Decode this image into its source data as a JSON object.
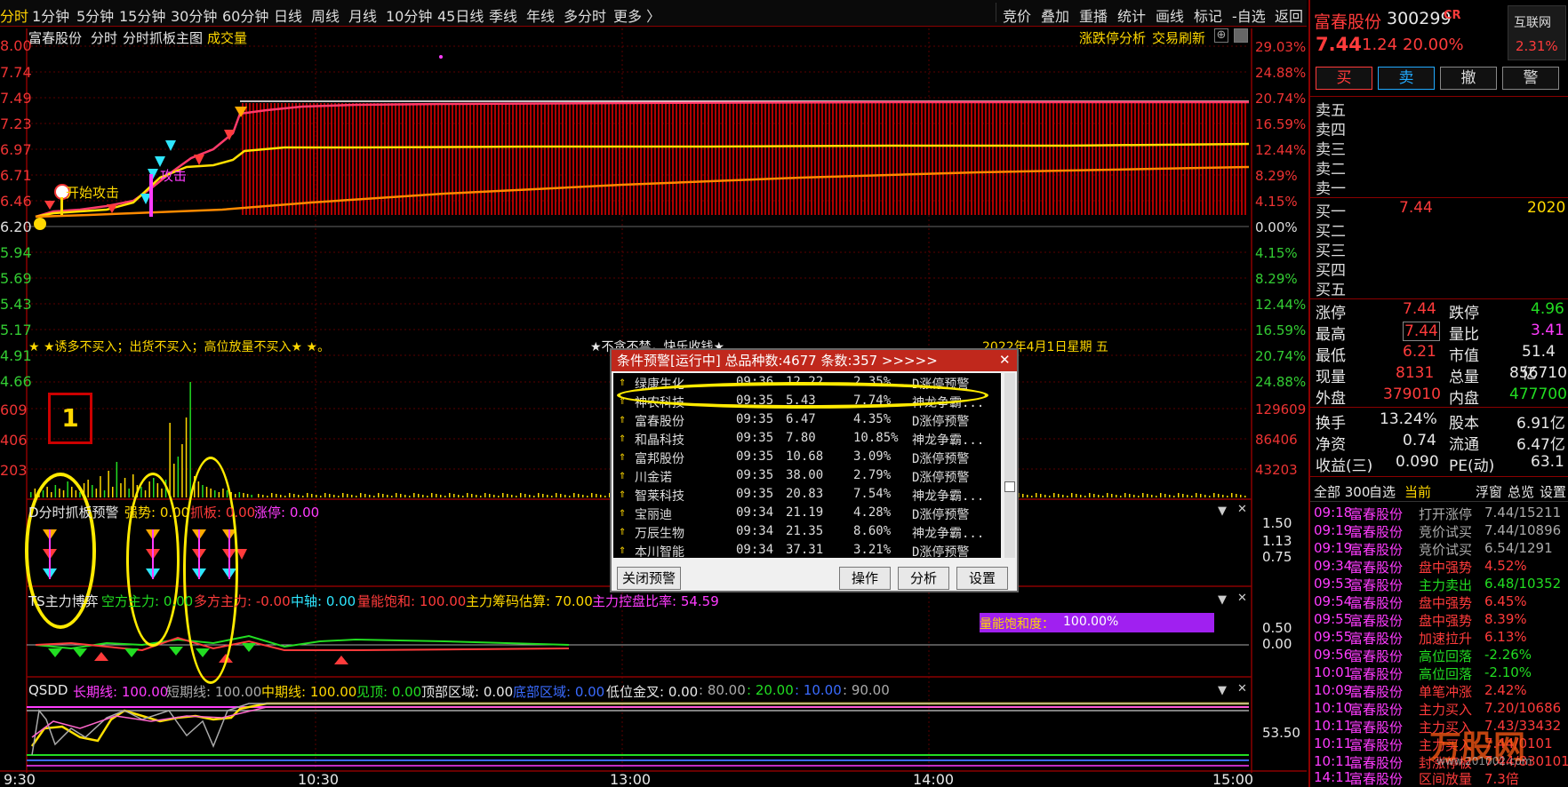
{
  "tabs": {
    "t1": "分时",
    "t2": "1分钟",
    "t3": "5分钟",
    "t4": "15分钟",
    "t5": "30分钟",
    "t6": "60分钟",
    "t7": "日线",
    "t8": "周线",
    "t9": "月线",
    "t10": "10分钟",
    "t11": "45日线",
    "t12": "季线",
    "t13": "年线",
    "t14": "多分时",
    "t15": "更多 〉"
  },
  "toolbar": {
    "b1": "竞价",
    "b2": "叠加",
    "b3": "重播",
    "b4": "统计",
    "b5": "画线",
    "b6": "标记",
    "b7": "-自选",
    "b8": "返回"
  },
  "chart_header": {
    "stock": "富春股份",
    "mode": "分时",
    "template": "分时抓板主图",
    "indicator": "成交量",
    "analysis": "涨跌停分析",
    "trade": "交易刷新"
  },
  "price_axis": [
    "8.00",
    "7.74",
    "7.49",
    "7.23",
    "6.97",
    "6.71",
    "6.46",
    "6.20",
    "5.94",
    "5.69",
    "5.43",
    "5.17",
    "4.91",
    "4.66"
  ],
  "pct_axis": [
    "29.03%",
    "24.88%",
    "20.74%",
    "16.59%",
    "12.44%",
    "8.29%",
    "4.15%",
    "0.00%",
    "4.15%",
    "8.29%",
    "12.44%",
    "16.59%",
    "20.74%",
    "24.88%"
  ],
  "vol_axis_left": [
    "609",
    "406",
    "203"
  ],
  "vol_axis_right": [
    "129609",
    "86406",
    "43203"
  ],
  "annotations": {
    "start_attack": "开始攻击",
    "attack": "攻击",
    "slogan": "★ ★诱多不买入；出货不买入；高位放量不买入★ ★。",
    "motto": "★不贪不禁，快乐收钱★",
    "date": "2022年4月1日星期 五"
  },
  "overlay_label": "1",
  "panel1": {
    "name": "D分时抓板预警",
    "strength": "强势: 0.00",
    "grab": "抓板: 0.00",
    "limit": "涨停: 0.00",
    "ax1": "1.50",
    "ax2": "1.13",
    "ax3": "0.75"
  },
  "panel2": {
    "name": "TS主力博弈",
    "short": "空方主力: 0.00",
    "long": "多方主力: -0.00",
    "axis": "中轴: 0.00",
    "saturation": "量能饱和: 100.00",
    "chip": "主力筹码估算: 70.00",
    "control": "主力控盘比率: 54.59",
    "sat_label": "量能饱和度：",
    "sat_value": "100.00%",
    "sat_pct": 100,
    "ax1": "0.50",
    "ax2": "0.00"
  },
  "panel3": {
    "name": "QSDD",
    "longline": "长期线: 100.00",
    "shortline": "短期线: 100.00",
    "midline": "中期线: 100.00",
    "seetop": "见顶: 0.00",
    "topzone": "顶部区域: 0.00",
    "bottomzone": "底部区域: 0.00",
    "lowcross": "低位金叉: 0.00",
    "v80": ": 80.00",
    "v20": ": 20.00",
    "v10": ": 10.00",
    "v90": ": 90.00",
    "ax1": "53.50"
  },
  "time_axis": [
    "9:30",
    "10:30",
    "13:00",
    "14:00",
    "15:00"
  ],
  "quote": {
    "name": "富春股份",
    "code": "300299",
    "tag": "CR",
    "price": "7.44",
    "change": "1.24",
    "pct": "20.00%",
    "sector": "互联网",
    "sector_pct": "2.31%"
  },
  "buttons": {
    "buy": "买",
    "sell": "卖",
    "cancel": "撤",
    "alert": "警"
  },
  "orderbook": {
    "sell": [
      "卖五",
      "卖四",
      "卖三",
      "卖二",
      "卖一"
    ],
    "buy": [
      "买一",
      "买二",
      "买三",
      "买四",
      "买五"
    ],
    "buy1_price": "7.44",
    "buy1_vol": "2020"
  },
  "stats": [
    {
      "l": "涨停",
      "v": "7.44",
      "l2": "跌停",
      "v2": "4.96"
    },
    {
      "l": "最高",
      "v": "7.44",
      "l2": "量比",
      "v2": "3.41"
    },
    {
      "l": "最低",
      "v": "6.21",
      "l2": "市值",
      "v2": "51.4亿"
    },
    {
      "l": "现量",
      "v": "8131",
      "l2": "总量",
      "v2": "856710"
    },
    {
      "l": "外盘",
      "v": "379010",
      "l2": "内盘",
      "v2": "477700"
    },
    {
      "l": "换手",
      "v": "13.24%",
      "l2": "股本",
      "v2": "6.91亿"
    },
    {
      "l": "净资",
      "v": "0.74",
      "l2": "流通",
      "v2": "6.47亿"
    },
    {
      "l": "收益(三)",
      "v": "0.090",
      "l2": "PE(动)",
      "v2": "63.1"
    }
  ],
  "feed_tabs": {
    "all": "全部 300",
    "watch": "自选",
    "current": "当前",
    "float": "浮窗",
    "overview": "总览",
    "settings": "设置"
  },
  "feed": [
    {
      "t": "09:18",
      "n": "富春股份",
      "e": "打开涨停",
      "v": "7.44/15211"
    },
    {
      "t": "09:19",
      "n": "富春股份",
      "e": "竞价试买",
      "v": "7.44/10896"
    },
    {
      "t": "09:19",
      "n": "富春股份",
      "e": "竞价试买",
      "v": "6.54/1291"
    },
    {
      "t": "09:34",
      "n": "富春股份",
      "e": "盘中强势",
      "v": "4.52%"
    },
    {
      "t": "09:53",
      "n": "富春股份",
      "e": "主力卖出",
      "v": "6.48/10352"
    },
    {
      "t": "09:54",
      "n": "富春股份",
      "e": "盘中强势",
      "v": "6.45%"
    },
    {
      "t": "09:55",
      "n": "富春股份",
      "e": "盘中强势",
      "v": "8.39%"
    },
    {
      "t": "09:55",
      "n": "富春股份",
      "e": "加速拉升",
      "v": "6.13%"
    },
    {
      "t": "09:56",
      "n": "富春股份",
      "e": "高位回落",
      "v": "-2.26%"
    },
    {
      "t": "10:01",
      "n": "富春股份",
      "e": "高位回落",
      "v": "-2.10%"
    },
    {
      "t": "10:09",
      "n": "富春股份",
      "e": "单笔冲涨",
      "v": "2.42%"
    },
    {
      "t": "10:10",
      "n": "富春股份",
      "e": "主力买入",
      "v": "7.20/10686"
    },
    {
      "t": "10:11",
      "n": "富春股份",
      "e": "主力买入",
      "v": "7.43/33432"
    },
    {
      "t": "10:11",
      "n": "富春股份",
      "e": "主力买入",
      "v": "7.44/0101"
    },
    {
      "t": "10:11",
      "n": "富春股份",
      "e": "封涨停板",
      "v": "7.44/830101"
    },
    {
      "t": "14:11",
      "n": "富春股份",
      "e": "区间放量",
      "v": "7.3倍"
    }
  ],
  "watermark": "万股网",
  "watermark_url": "www.201002.com",
  "alert": {
    "title": "条件预警[运行中] 总品种数:4677 条数:357 >>>>>",
    "rows": [
      {
        "n": "绿康生化",
        "t": "09:36",
        "p": "12.22",
        "c": "2.35%",
        "s": "D涨停预警"
      },
      {
        "n": "神农科技",
        "t": "09:35",
        "p": "5.43",
        "c": "7.74%",
        "s": "神龙争霸..."
      },
      {
        "n": "富春股份",
        "t": "09:35",
        "p": "6.47",
        "c": "4.35%",
        "s": "D涨停预警"
      },
      {
        "n": "和晶科技",
        "t": "09:35",
        "p": "7.80",
        "c": "10.85%",
        "s": "神龙争霸..."
      },
      {
        "n": "富邦股份",
        "t": "09:35",
        "p": "10.68",
        "c": "3.09%",
        "s": "D涨停预警"
      },
      {
        "n": "川金诺",
        "t": "09:35",
        "p": "38.00",
        "c": "2.79%",
        "s": "D涨停预警"
      },
      {
        "n": "智莱科技",
        "t": "09:35",
        "p": "20.83",
        "c": "7.54%",
        "s": "神龙争霸..."
      },
      {
        "n": "宝丽迪",
        "t": "09:34",
        "p": "21.19",
        "c": "4.28%",
        "s": "D涨停预警"
      },
      {
        "n": "万辰生物",
        "t": "09:34",
        "p": "21.35",
        "c": "8.60%",
        "s": "神龙争霸..."
      },
      {
        "n": "本川智能",
        "t": "09:34",
        "p": "37.31",
        "c": "3.21%",
        "s": "D涨停预警"
      }
    ],
    "btn_close": "关闭预警",
    "btn_op": "操作",
    "btn_an": "分析",
    "btn_set": "设置"
  },
  "colors": {
    "up": "#ff3b3b",
    "down": "#22dd22",
    "accent": "#ffd800",
    "border": "#8b0000"
  }
}
